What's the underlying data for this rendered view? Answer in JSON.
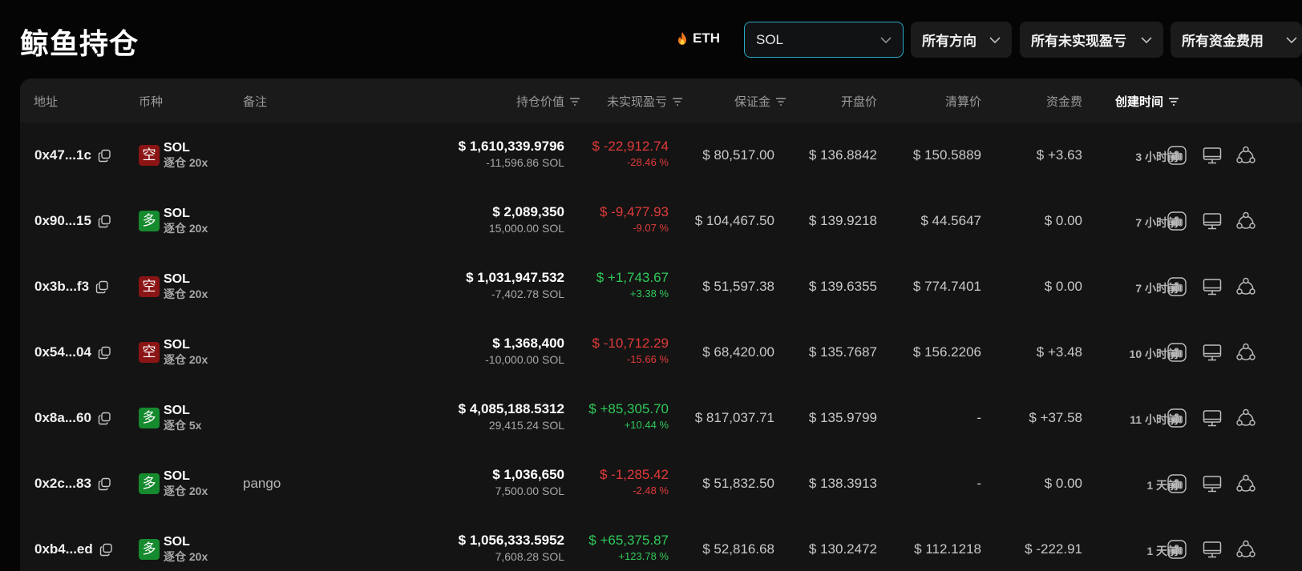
{
  "header": {
    "title": "鲸鱼持仓",
    "eth_label": "ETH",
    "coin_select": "SOL",
    "direction_select": "所有方向",
    "pnl_select": "所有未实现盈亏",
    "fee_select": "所有资金费用"
  },
  "table": {
    "columns": {
      "address": "地址",
      "coin": "币种",
      "note": "备注",
      "value": "持仓价值",
      "upnl": "未实现盈亏",
      "margin": "保证金",
      "open_price": "开盘价",
      "liq_price": "清算价",
      "funding": "资金费",
      "created": "创建时间"
    },
    "rows": [
      {
        "address": "0x47...1c",
        "side": "空",
        "side_type": "short",
        "coin": "SOL",
        "leverage": "逐仓 20x",
        "note": "",
        "value": "$ 1,610,339.9796",
        "size": "-11,596.86 SOL",
        "upnl": "$ -22,912.74",
        "upnl_pct": "-28.46 %",
        "upnl_type": "neg",
        "margin": "$ 80,517.00",
        "open_price": "$ 136.8842",
        "liq_price": "$ 150.5889",
        "funding": "$ +3.63",
        "funding_type": "pos",
        "created": "3 小时前"
      },
      {
        "address": "0x90...15",
        "side": "多",
        "side_type": "long",
        "coin": "SOL",
        "leverage": "逐仓 20x",
        "note": "",
        "value": "$ 2,089,350",
        "size": "15,000.00 SOL",
        "upnl": "$ -9,477.93",
        "upnl_pct": "-9.07 %",
        "upnl_type": "neg",
        "margin": "$ 104,467.50",
        "open_price": "$ 139.9218",
        "liq_price": "$ 44.5647",
        "funding": "$ 0.00",
        "funding_type": "zero",
        "created": "7 小时前"
      },
      {
        "address": "0x3b...f3",
        "side": "空",
        "side_type": "short",
        "coin": "SOL",
        "leverage": "逐仓 20x",
        "note": "",
        "value": "$ 1,031,947.532",
        "size": "-7,402.78 SOL",
        "upnl": "$ +1,743.67",
        "upnl_pct": "+3.38 %",
        "upnl_type": "pos",
        "margin": "$ 51,597.38",
        "open_price": "$ 139.6355",
        "liq_price": "$ 774.7401",
        "funding": "$ 0.00",
        "funding_type": "zero",
        "created": "7 小时前"
      },
      {
        "address": "0x54...04",
        "side": "空",
        "side_type": "short",
        "coin": "SOL",
        "leverage": "逐仓 20x",
        "note": "",
        "value": "$ 1,368,400",
        "size": "-10,000.00 SOL",
        "upnl": "$ -10,712.29",
        "upnl_pct": "-15.66 %",
        "upnl_type": "neg",
        "margin": "$ 68,420.00",
        "open_price": "$ 135.7687",
        "liq_price": "$ 156.2206",
        "funding": "$ +3.48",
        "funding_type": "pos",
        "created": "10 小时前"
      },
      {
        "address": "0x8a...60",
        "side": "多",
        "side_type": "long",
        "coin": "SOL",
        "leverage": "逐仓 5x",
        "note": "",
        "value": "$ 4,085,188.5312",
        "size": "29,415.24 SOL",
        "upnl": "$ +85,305.70",
        "upnl_pct": "+10.44 %",
        "upnl_type": "pos",
        "margin": "$ 817,037.71",
        "open_price": "$ 135.9799",
        "liq_price": "-",
        "funding": "$ +37.58",
        "funding_type": "pos",
        "created": "11 小时前"
      },
      {
        "address": "0x2c...83",
        "side": "多",
        "side_type": "long",
        "coin": "SOL",
        "leverage": "逐仓 20x",
        "note": "pango",
        "value": "$ 1,036,650",
        "size": "7,500.00 SOL",
        "upnl": "$ -1,285.42",
        "upnl_pct": "-2.48 %",
        "upnl_type": "neg",
        "margin": "$ 51,832.50",
        "open_price": "$ 138.3913",
        "liq_price": "-",
        "funding": "$ 0.00",
        "funding_type": "zero",
        "created": "1 天前"
      },
      {
        "address": "0xb4...ed",
        "side": "多",
        "side_type": "long",
        "coin": "SOL",
        "leverage": "逐仓 20x",
        "note": "",
        "value": "$ 1,056,333.5952",
        "size": "7,608.28 SOL",
        "upnl": "$ +65,375.87",
        "upnl_pct": "+123.78 %",
        "upnl_type": "pos",
        "margin": "$ 52,816.68",
        "open_price": "$ 130.2472",
        "liq_price": "$ 112.1218",
        "funding": "$ -222.91",
        "funding_type": "neg",
        "created": "1 天前"
      }
    ]
  },
  "icons": {
    "eth": "flame-icon",
    "select": "chevron-down-icon",
    "sort": "filter-icon",
    "copy": "copy-icon",
    "actions": [
      "bar-chart-icon",
      "monitor-icon",
      "share-icon"
    ]
  },
  "colors": {
    "positive": "#2fc95a",
    "negative": "#e03a3a",
    "short_badge": "#8b1515",
    "long_badge": "#168a2e",
    "select_border": "#2aa9c6"
  }
}
